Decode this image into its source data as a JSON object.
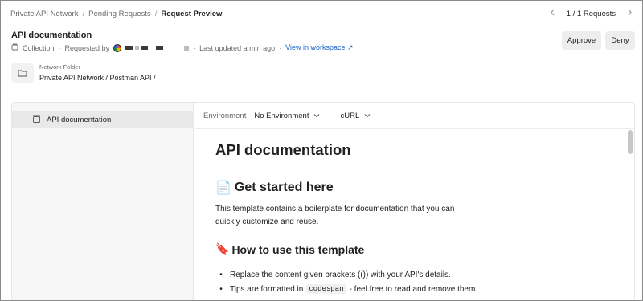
{
  "breadcrumb": {
    "items": [
      "Private API Network",
      "Pending Requests"
    ],
    "current": "Request Preview",
    "separator": "/"
  },
  "pager": {
    "prev_icon": "chevron-left-icon",
    "text": "1 / 1 Requests",
    "next_icon": "chevron-right-icon"
  },
  "request": {
    "title": "API documentation",
    "type": "Collection",
    "requested_by_label": "Requested by",
    "last_updated": "Last updated a min ago",
    "view_link": "View in workspace ↗"
  },
  "actions": {
    "approve": "Approve",
    "deny": "Deny"
  },
  "folder": {
    "label": "Network Folder",
    "path": "Private API Network / Postman API /"
  },
  "sidebar": {
    "items": [
      {
        "label": "API documentation",
        "icon": "collection-icon"
      }
    ]
  },
  "environment": {
    "label": "Environment",
    "value": "No Environment",
    "language": "cURL"
  },
  "doc": {
    "title": "API documentation",
    "section1": {
      "emoji": "📄",
      "heading": "Get started here",
      "body": "This template contains a boilerplate for documentation that you can quickly customize and reuse."
    },
    "section2": {
      "emoji": "🔖",
      "heading": "How to use this template",
      "bullet1": "Replace the content given brackets (()) with your API's details.",
      "bullet2_pre": "Tips are formatted in",
      "bullet2_code": "codespan",
      "bullet2_post": "- feel free to read and remove them."
    }
  },
  "colors": {
    "link": "#1a63c9",
    "button_bg": "#ededed",
    "sidebar_bg": "#f6f6f6",
    "sidebar_selected_bg": "#e9e9e9"
  }
}
